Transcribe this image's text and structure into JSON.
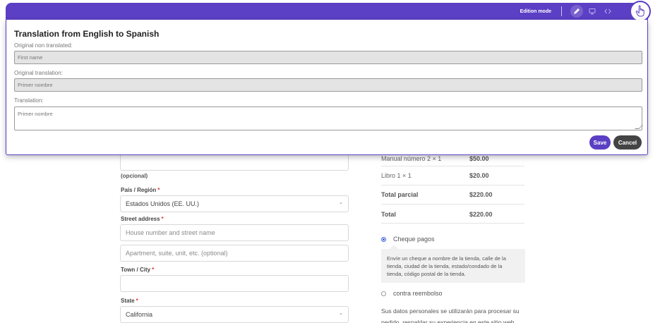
{
  "toolbar": {
    "mode_label": "Edition mode",
    "accent_color": "#5b3fc4",
    "tools": [
      "pencil-icon",
      "monitor-icon",
      "code-icon",
      "hand-pointer-icon"
    ]
  },
  "modal": {
    "title": "Translation from English to Spanish",
    "original_label": "Original non translated:",
    "original_value": "First name",
    "original_translation_label": "Original translation:",
    "original_translation_value": "Primer nombre",
    "translation_label": "Translation:",
    "translation_value": "Primer nombre",
    "save_label": "Save",
    "cancel_label": "Cancel"
  },
  "form": {
    "optional_hint": "(opcional)",
    "country_label": "País / Región",
    "country_value": "Estados Unidos (EE. UU.)",
    "street_label": "Street address",
    "street_placeholder": "House number and street name",
    "street2_placeholder": "Apartment, suite, unit, etc. (optional)",
    "city_label": "Town / City",
    "state_label": "State",
    "state_value": "California",
    "required_mark": "*"
  },
  "order": {
    "partial_row_label": "Manual número 2 × 1",
    "partial_row_value": "$50.00",
    "item_label": "Libro 1 × 1",
    "item_value": "$20.00",
    "subtotal_label": "Total parcial",
    "subtotal_value": "$220.00",
    "total_label": "Total",
    "total_value": "$220.00"
  },
  "payment": {
    "cheque_label": "Cheque pagos",
    "cheque_description": "Envíe un cheque a nombre de la tienda, calle de la tienda, ciudad de la tienda, estado/condado de la tienda, código postal de la tienda.",
    "cod_label": "contra reembolso",
    "privacy_text": "Sus datos personales se utilizarán para procesar su pedido, respaldar su experiencia en este sitio web"
  }
}
